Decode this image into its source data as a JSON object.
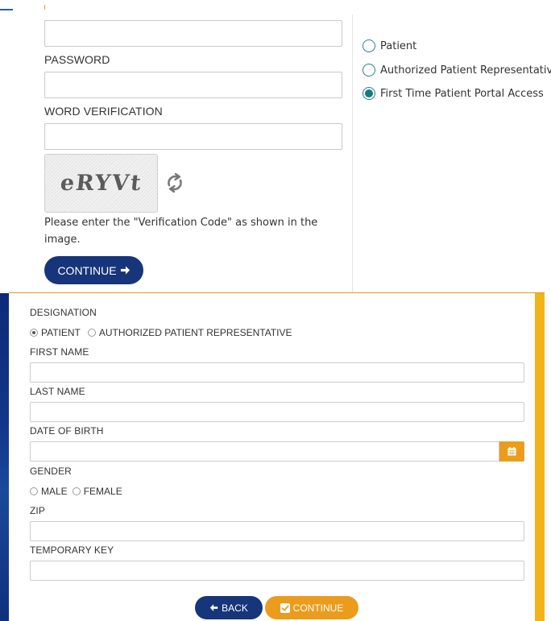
{
  "login": {
    "username_value": "",
    "password_label": "PASSWORD",
    "password_value": "",
    "word_verification_label": "WORD VERIFICATION",
    "word_verification_value": "",
    "captcha_text": "eRYVt",
    "captcha_help": "Please enter the \"Verification Code\" as shown in the image.",
    "continue_label": "CONTINUE"
  },
  "login_type": {
    "options": [
      {
        "label": "Patient",
        "selected": false
      },
      {
        "label": "Authorized Patient Representative",
        "selected": false
      },
      {
        "label": "First Time Patient Portal Access",
        "selected": true
      }
    ]
  },
  "registration": {
    "designation_label": "DESIGNATION",
    "designation_options": [
      {
        "label": "PATIENT",
        "selected": true
      },
      {
        "label": "AUTHORIZED PATIENT REPRESENTATIVE",
        "selected": false
      }
    ],
    "first_name_label": "FIRST NAME",
    "first_name_value": "",
    "last_name_label": "LAST NAME",
    "last_name_value": "",
    "dob_label": "DATE OF BIRTH",
    "dob_value": "",
    "gender_label": "GENDER",
    "gender_options": [
      {
        "label": "MALE",
        "selected": false
      },
      {
        "label": "FEMALE",
        "selected": false
      }
    ],
    "zip_label": "ZIP",
    "zip_value": "",
    "temporary_key_label": "TEMPORARY KEY",
    "temporary_key_value": "",
    "back_label": "BACK",
    "continue_label": "CONTINUE"
  },
  "colors": {
    "navy": "#16357a",
    "orange": "#eb9c1d",
    "teal": "#137c7c",
    "gold_bar": "#f1b318"
  },
  "icons": [
    "refresh-icon",
    "arrow-right-icon",
    "calendar-icon",
    "arrow-left-icon",
    "checkbox-icon"
  ]
}
